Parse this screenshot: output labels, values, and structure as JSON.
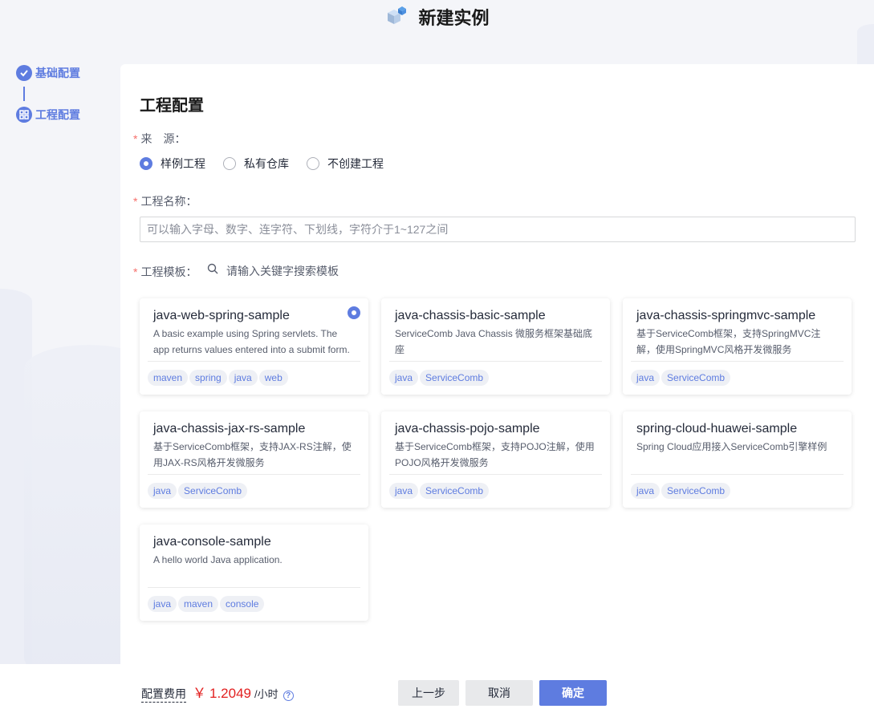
{
  "page": {
    "title": "新建实例"
  },
  "steps": [
    {
      "label": "基础配置",
      "status": "done"
    },
    {
      "label": "工程配置",
      "status": "active"
    }
  ],
  "section_title": "工程配置",
  "source": {
    "label": "来　源：",
    "options": [
      {
        "label": "样例工程",
        "checked": true
      },
      {
        "label": "私有仓库",
        "checked": false
      },
      {
        "label": "不创建工程",
        "checked": false
      }
    ]
  },
  "project_name": {
    "label": "工程名称：",
    "value": "",
    "placeholder": "可以输入字母、数字、连字符、下划线，字符介于1~127之间"
  },
  "template": {
    "label": "工程模板：",
    "search_placeholder": "请输入关键字搜索模板",
    "cards": [
      {
        "name": "java-web-spring-sample",
        "desc": "A basic example using Spring servlets. The app returns values entered into a submit form.",
        "tags": [
          "maven",
          "spring",
          "java",
          "web"
        ],
        "selected": true
      },
      {
        "name": "java-chassis-basic-sample",
        "desc": "ServiceComb Java Chassis 微服务框架基础底座",
        "tags": [
          "java",
          "ServiceComb"
        ],
        "selected": false
      },
      {
        "name": "java-chassis-springmvc-sample",
        "desc": "基于ServiceComb框架，支持SpringMVC注解，使用SpringMVC风格开发微服务",
        "tags": [
          "java",
          "ServiceComb"
        ],
        "selected": false
      },
      {
        "name": "java-chassis-jax-rs-sample",
        "desc": "基于ServiceComb框架，支持JAX-RS注解，使用JAX-RS风格开发微服务",
        "tags": [
          "java",
          "ServiceComb"
        ],
        "selected": false
      },
      {
        "name": "java-chassis-pojo-sample",
        "desc": "基于ServiceComb框架，支持POJO注解，使用POJO风格开发微服务",
        "tags": [
          "java",
          "ServiceComb"
        ],
        "selected": false
      },
      {
        "name": "spring-cloud-huawei-sample",
        "desc": "Spring Cloud应用接入ServiceComb引擎样例",
        "tags": [
          "java",
          "ServiceComb"
        ],
        "selected": false
      },
      {
        "name": "java-console-sample",
        "desc": "A hello world Java application.",
        "tags": [
          "java",
          "maven",
          "console"
        ],
        "selected": false
      }
    ]
  },
  "footer": {
    "fee_label": "配置费用",
    "currency": "￥",
    "price": "1.2049",
    "unit": "/小时",
    "help_icon": "question-circle-icon",
    "prev_label": "上一步",
    "cancel_label": "取消",
    "ok_label": "确定"
  },
  "colors": {
    "accent": "#5e7ce0",
    "price": "#e21f1f",
    "required": "#f66f6a"
  }
}
